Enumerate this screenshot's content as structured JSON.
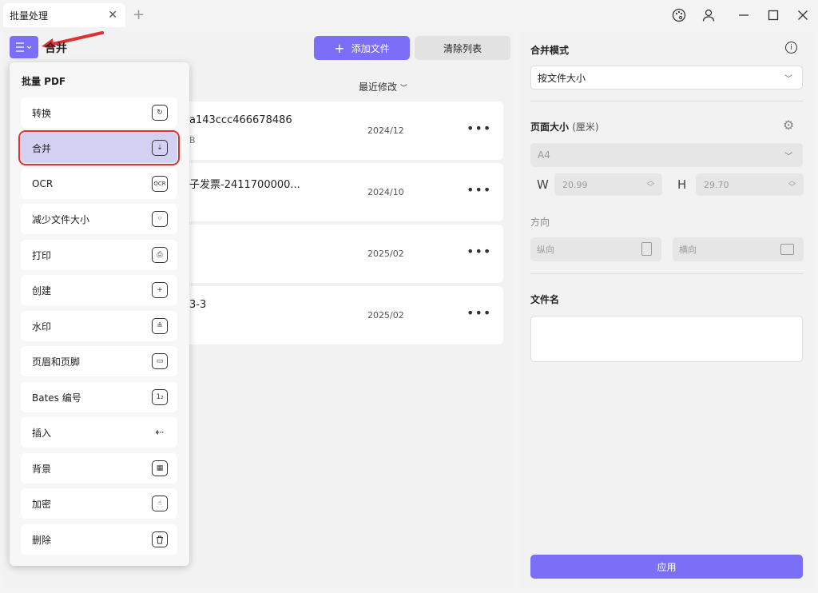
{
  "titlebar": {
    "tab_title": "批量处理",
    "tab_close": "✕",
    "tab_add": "+"
  },
  "main": {
    "title": "合并",
    "add_file_label": "添加文件",
    "clear_list_label": "清除列表",
    "sort_label": "最近修改",
    "files": [
      {
        "name": "a143ccc466678486",
        "sub": "B",
        "date": "2024/12"
      },
      {
        "name": "子发票-2411700000...",
        "sub": "",
        "date": "2024/10"
      },
      {
        "name": "",
        "sub": "",
        "date": "2025/02"
      },
      {
        "name": "3-3",
        "sub": "",
        "date": "2025/02"
      }
    ]
  },
  "dropdown": {
    "title": "批量 PDF",
    "items": [
      {
        "label": "转换",
        "icon": "convert-icon",
        "glyph": "↻"
      },
      {
        "label": "合并",
        "icon": "merge-icon",
        "glyph": "⇣",
        "selected": true
      },
      {
        "label": "OCR",
        "icon": "ocr-icon",
        "glyph": "OCR"
      },
      {
        "label": "减少文件大小",
        "icon": "compress-icon",
        "glyph": "⁘"
      },
      {
        "label": "打印",
        "icon": "printer-icon",
        "glyph": "⎙"
      },
      {
        "label": "创建",
        "icon": "create-icon",
        "glyph": "+"
      },
      {
        "label": "水印",
        "icon": "watermark-icon",
        "glyph": "≗"
      },
      {
        "label": "页眉和页脚",
        "icon": "header-footer-icon",
        "glyph": "▭"
      },
      {
        "label": "Bates 编号",
        "icon": "bates-icon",
        "glyph": "1₂"
      },
      {
        "label": "插入",
        "icon": "insert-icon",
        "glyph": "⇠"
      },
      {
        "label": "背景",
        "icon": "background-icon",
        "glyph": "▦"
      },
      {
        "label": "加密",
        "icon": "encrypt-icon",
        "glyph": "☝"
      },
      {
        "label": "删除",
        "icon": "delete-icon",
        "glyph": "🗑"
      }
    ]
  },
  "right": {
    "merge_mode_label": "合并模式",
    "merge_mode_value": "按文件大小",
    "page_size_label": "页面大小",
    "page_size_unit": "(厘米)",
    "page_size_value": "A4",
    "width_letter": "W",
    "width_value": "20.99",
    "height_letter": "H",
    "height_value": "29.70",
    "orientation_label": "方向",
    "portrait_label": "纵向",
    "landscape_label": "横向",
    "filename_label": "文件名",
    "apply_label": "应用"
  },
  "colors": {
    "accent": "#7c6ff7",
    "highlight": "#e03131",
    "selected_bg": "#d3d0f2"
  }
}
